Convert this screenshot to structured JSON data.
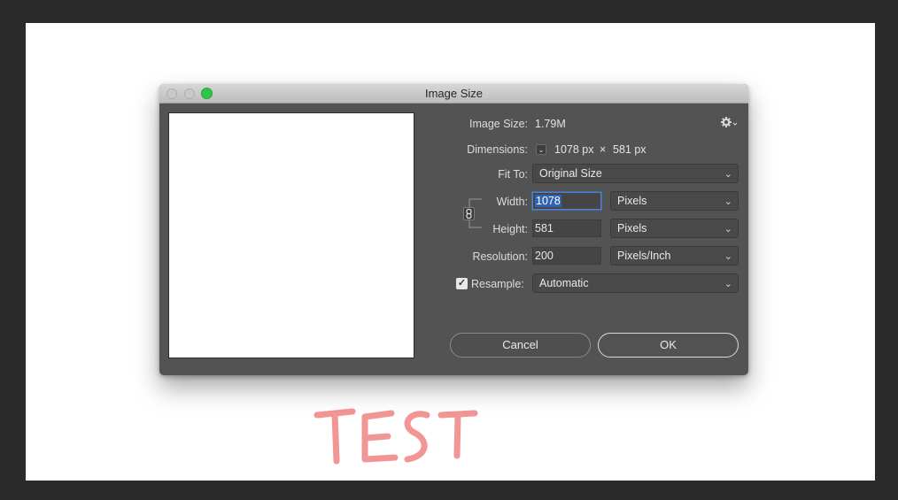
{
  "dialog": {
    "title": "Image Size",
    "gear_icon": "gear-icon"
  },
  "info": {
    "image_size_label": "Image Size:",
    "image_size_value": "1.79M",
    "dimensions_label": "Dimensions:",
    "dimensions_width": "1078 px",
    "dimensions_x": "×",
    "dimensions_height": "581 px"
  },
  "fit_to": {
    "label": "Fit To:",
    "value": "Original Size"
  },
  "width": {
    "label": "Width:",
    "value": "1078",
    "unit": "Pixels"
  },
  "height": {
    "label": "Height:",
    "value": "581",
    "unit": "Pixels"
  },
  "resolution": {
    "label": "Resolution:",
    "value": "200",
    "unit": "Pixels/Inch"
  },
  "resample": {
    "label": "Resample:",
    "checked": true,
    "value": "Automatic"
  },
  "buttons": {
    "cancel": "Cancel",
    "ok": "OK"
  },
  "canvas": {
    "handwritten_text": "TEST",
    "handwritten_color": "#f08080"
  }
}
